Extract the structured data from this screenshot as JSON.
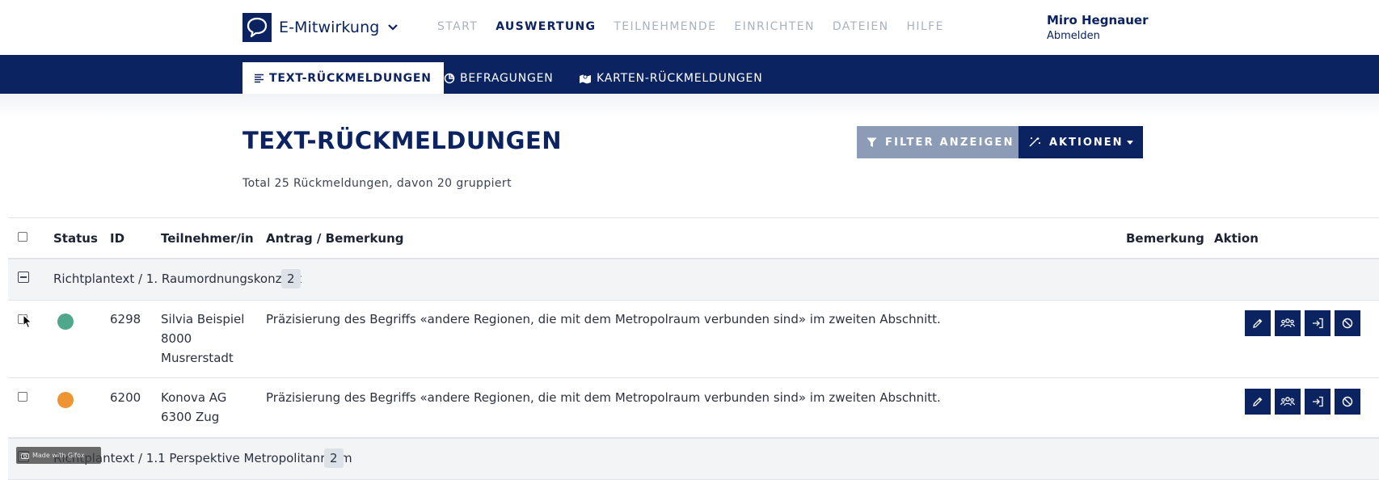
{
  "header": {
    "app_name": "E-Mitwirkung",
    "nav": [
      {
        "label": "START",
        "active": false
      },
      {
        "label": "AUSWERTUNG",
        "active": true
      },
      {
        "label": "TEILNEHMENDE",
        "active": false
      },
      {
        "label": "EINRICHTEN",
        "active": false
      },
      {
        "label": "DATEIEN",
        "active": false
      },
      {
        "label": "HILFE",
        "active": false
      }
    ],
    "user_name": "Miro Hegnauer",
    "logout_label": "Abmelden"
  },
  "subnav": {
    "tabs": [
      {
        "label": "TEXT-RÜCKMELDUNGEN",
        "icon": "text-lines-icon",
        "active": true
      },
      {
        "label": "BEFRAGUNGEN",
        "icon": "chart-pie-icon",
        "active": false
      },
      {
        "label": "KARTEN-RÜCKMELDUNGEN",
        "icon": "map-icon",
        "active": false
      }
    ]
  },
  "main": {
    "title": "TEXT-RÜCKMELDUNGEN",
    "total_text": "Total 25 Rückmeldungen, davon 20 gruppiert",
    "filter_label": "FILTER ANZEIGEN",
    "actions_label": "AKTIONEN"
  },
  "table": {
    "columns": [
      "Status",
      "ID",
      "Teilnehmer/in",
      "Antrag / Bemerkung",
      "Bemerkung",
      "Aktion"
    ],
    "groups": [
      {
        "label": "Richtplantext / 1. Raumordnungskonzept",
        "count": "2",
        "rows": [
          {
            "status_color": "#4fa88b",
            "id": "6298",
            "participant": [
              "Silvia Beispiel",
              "8000",
              "Musrerstadt"
            ],
            "text": "Präzisierung des Begriffs «andere Regionen, die mit dem Metropolraum verbunden sind» im zweiten Abschnitt."
          },
          {
            "status_color": "#ee9433",
            "id": "6200",
            "participant": [
              "Konova AG",
              "6300 Zug"
            ],
            "text": "Präzisierung des Begriffs «andere Regionen, die mit dem Metropolraum verbunden sind» im zweiten Abschnitt."
          }
        ]
      },
      {
        "label": "Richtplantext / 1.1 Perspektive Metropolitanraum",
        "count": "2",
        "rows": []
      }
    ],
    "row_actions": [
      "edit-icon",
      "group-icon",
      "assign-icon",
      "block-icon"
    ]
  },
  "overlay": {
    "watermark": "Made with Gifox"
  },
  "colors": {
    "primary": "#0b2361",
    "filter_button": "#8d9cb6",
    "group_bg": "#f3f4f6"
  }
}
